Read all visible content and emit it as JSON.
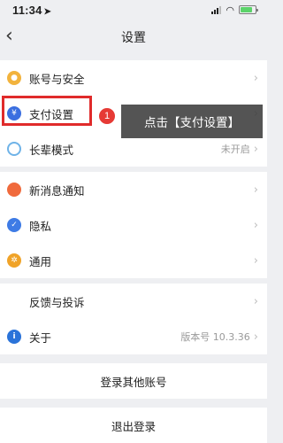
{
  "status_bar": {
    "time": "11:34",
    "location_arrow": "➤"
  },
  "nav": {
    "back_glyph": "‹",
    "title": "设置"
  },
  "settings": {
    "account": {
      "label": "账号与安全"
    },
    "payment": {
      "label": "支付设置"
    },
    "elder_mode": {
      "label": "长辈模式",
      "value": "未开启"
    },
    "notifications": {
      "label": "新消息通知"
    },
    "privacy": {
      "label": "隐私"
    },
    "general": {
      "label": "通用"
    },
    "feedback": {
      "label": "反馈与投诉"
    },
    "about": {
      "label": "关于",
      "value": "版本号 10.3.36"
    }
  },
  "actions": {
    "login_other": "登录其他账号",
    "logout": "退出登录"
  },
  "annotation": {
    "step_number": "1",
    "tip_text": "点击【支付设置】"
  },
  "chevron": "›",
  "colors": {
    "highlight_border": "#e02b2b",
    "badge": "#e63a35",
    "tip_bg": "#3c3c3c"
  }
}
